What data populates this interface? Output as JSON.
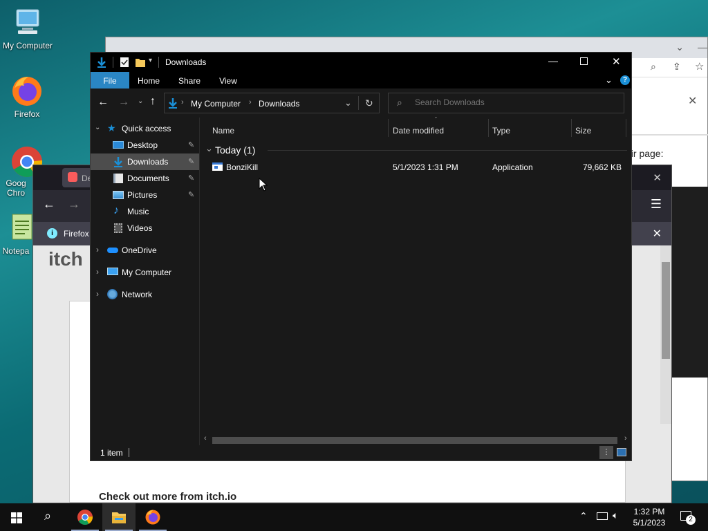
{
  "desktop": {
    "icons": [
      {
        "label": "My Computer"
      },
      {
        "label": "Firefox"
      },
      {
        "label": "Goog\nChro"
      },
      {
        "label": "Notepa"
      }
    ]
  },
  "chrome_bg": {
    "page_text": "eir page:"
  },
  "firefox_bg": {
    "tab_label": "De",
    "info_bar_text": "Firefox",
    "page_logo": "itch",
    "page_footer": "Check out more from itch.io"
  },
  "explorer": {
    "title": "Downloads",
    "ribbon_tabs": [
      "File",
      "Home",
      "Share",
      "View"
    ],
    "breadcrumb": [
      "My Computer",
      "Downloads"
    ],
    "search_placeholder": "Search Downloads",
    "nav": {
      "quick_access": "Quick access",
      "items": [
        "Desktop",
        "Downloads",
        "Documents",
        "Pictures",
        "Music",
        "Videos"
      ],
      "onedrive": "OneDrive",
      "my_computer": "My Computer",
      "network": "Network"
    },
    "columns": [
      "Name",
      "Date modified",
      "Type",
      "Size"
    ],
    "group_label": "Today (1)",
    "files": [
      {
        "name": "BonziKill",
        "date": "5/1/2023 1:31 PM",
        "type": "Application",
        "size": "79,662 KB"
      }
    ],
    "status": "1 item"
  },
  "taskbar": {
    "time": "1:32 PM",
    "date": "5/1/2023",
    "notification_count": "2"
  },
  "colors": {
    "accent": "#1a8fd6",
    "file_tab": "#2a86c4",
    "selected": "#4d4d4d"
  }
}
